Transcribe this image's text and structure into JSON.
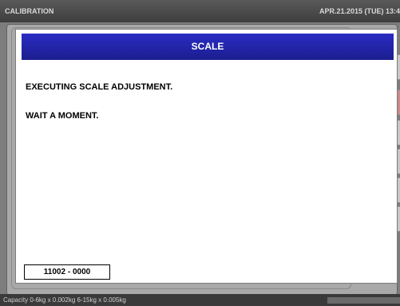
{
  "header": {
    "title": "CALIBRATION",
    "datetime": "APR.21.2015 (TUE)  13:4"
  },
  "dialog": {
    "title": "SCALE",
    "messages": [
      "EXECUTING SCALE ADJUSTMENT.",
      "WAIT A MOMENT."
    ],
    "code": "11002 - 0000"
  },
  "status": {
    "capacity": "Capacity 0-6kg x 0.002kg  6-15kg x 0.005kg"
  },
  "colors": {
    "header_blue": "#1c1d8e",
    "background_gray": "#7d7d7d"
  }
}
